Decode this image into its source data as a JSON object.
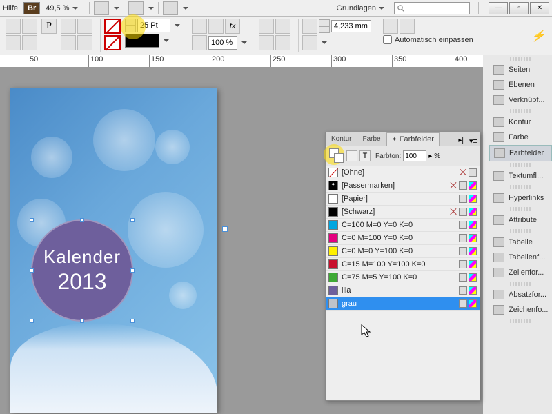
{
  "topbar": {
    "help": "Hilfe",
    "br": "Br",
    "zoom": "49,5 %",
    "workspace": "Grundlagen"
  },
  "controlbar": {
    "pt_value": "25 Pt",
    "opacity": "100 %",
    "offset": "4,233 mm",
    "autofit": "Automatisch einpassen"
  },
  "ruler": {
    "marks": [
      "50",
      "100",
      "150",
      "200",
      "250",
      "300",
      "350",
      "400"
    ]
  },
  "document": {
    "title_line1": "Kalender",
    "title_line2": "2013"
  },
  "dock": {
    "items": [
      "Seiten",
      "Ebenen",
      "Verknüpf...",
      "Kontur",
      "Farbe",
      "Farbfelder",
      "Textumfl...",
      "Hyperlinks",
      "Attribute",
      "Tabelle",
      "Tabellenf...",
      "Zellenfor...",
      "Absatzfor...",
      "Zeichenfo..."
    ],
    "active_index": 5
  },
  "swatches": {
    "tabs": [
      "Kontur",
      "Farbe",
      "Farbfelder"
    ],
    "active_tab": 2,
    "tint_label": "Farbton:",
    "tint_value": "100",
    "tint_unit": "%",
    "rows": [
      {
        "name": "[Ohne]",
        "chip": "none",
        "locked": true
      },
      {
        "name": "[Passermarken]",
        "chip": "reg",
        "locked": true
      },
      {
        "name": "[Papier]",
        "chip": "#ffffff"
      },
      {
        "name": "[Schwarz]",
        "chip": "#000000",
        "locked": true
      },
      {
        "name": "C=100 M=0 Y=0 K=0",
        "chip": "#00a6e0"
      },
      {
        "name": "C=0 M=100 Y=0 K=0",
        "chip": "#e4007f"
      },
      {
        "name": "C=0 M=0 Y=100 K=0",
        "chip": "#fff000"
      },
      {
        "name": "C=15 M=100 Y=100 K=0",
        "chip": "#c8102e"
      },
      {
        "name": "C=75 M=5 Y=100 K=0",
        "chip": "#3faa35"
      },
      {
        "name": "lila",
        "chip": "#6e5f9c"
      },
      {
        "name": "grau",
        "chip": "#bfc3ca",
        "selected": true
      }
    ]
  }
}
